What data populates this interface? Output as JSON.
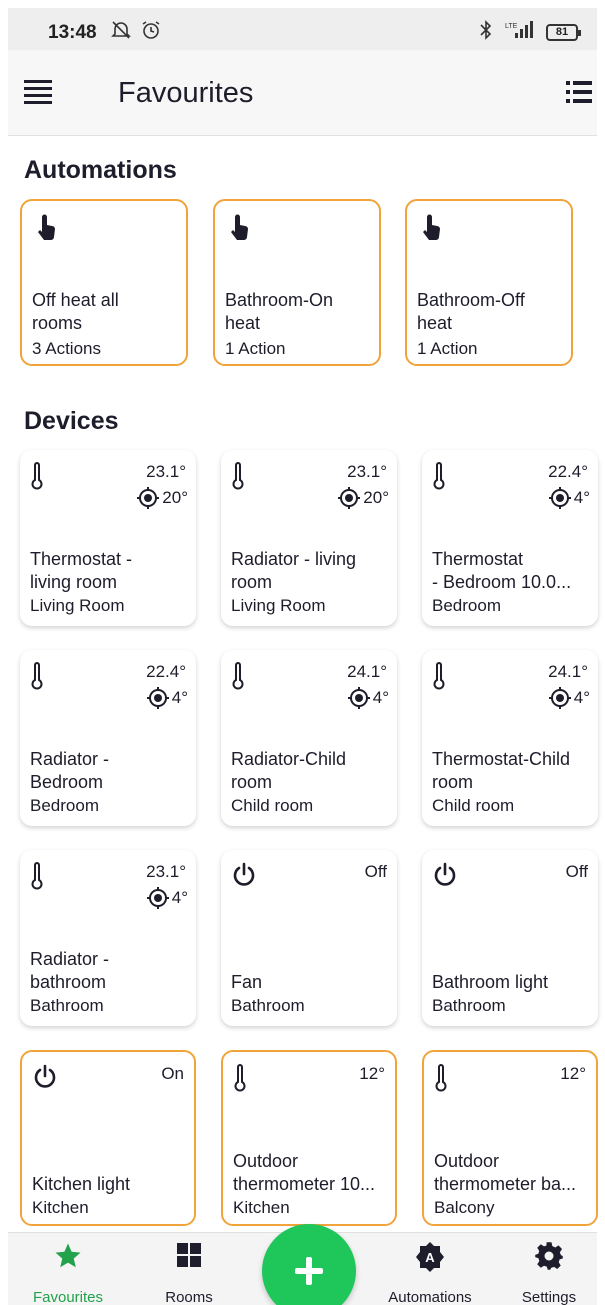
{
  "status": {
    "time": "13:48",
    "battery": "81"
  },
  "appbar": {
    "title": "Favourites"
  },
  "sections": {
    "automations": "Automations",
    "devices": "Devices"
  },
  "automations": [
    {
      "name": "Off heat all\nrooms",
      "sub": "3 Actions"
    },
    {
      "name": "Bathroom-On\nheat",
      "sub": "1 Action"
    },
    {
      "name": "Bathroom-Off\nheat",
      "sub": "1 Action"
    }
  ],
  "devices": [
    {
      "icon": "thermometer-icon",
      "value": "23.1°",
      "target": "20°",
      "name": "Thermostat -\nliving room",
      "room": "Living Room"
    },
    {
      "icon": "thermometer-icon",
      "value": "23.1°",
      "target": "20°",
      "name": "Radiator - living\nroom",
      "room": "Living Room"
    },
    {
      "icon": "thermometer-icon",
      "value": "22.4°",
      "target": "4°",
      "name": "Thermostat\n- Bedroom 10.0...",
      "room": "Bedroom"
    },
    {
      "icon": "thermometer-icon",
      "value": "22.4°",
      "target": "4°",
      "name": "Radiator -\nBedroom",
      "room": "Bedroom"
    },
    {
      "icon": "thermometer-icon",
      "value": "24.1°",
      "target": "4°",
      "name": "Radiator-Child\nroom",
      "room": "Child room"
    },
    {
      "icon": "thermometer-icon",
      "value": "24.1°",
      "target": "4°",
      "name": "Thermostat-Child\nroom",
      "room": "Child room"
    },
    {
      "icon": "thermometer-icon",
      "value": "23.1°",
      "target": "4°",
      "name": "Radiator -\nbathroom",
      "room": "Bathroom"
    },
    {
      "icon": "power-icon",
      "value": "Off",
      "target": "",
      "name": "Fan",
      "room": "Bathroom"
    },
    {
      "icon": "power-icon",
      "value": "Off",
      "target": "",
      "name": "Bathroom light",
      "room": "Bathroom"
    },
    {
      "icon": "power-icon",
      "value": "On",
      "target": "",
      "name": "Kitchen light",
      "room": "Kitchen"
    },
    {
      "icon": "thermometer-icon",
      "value": "12°",
      "target": "",
      "name": "Outdoor\nthermometer 10...",
      "room": "Kitchen"
    },
    {
      "icon": "thermometer-icon",
      "value": "12°",
      "target": "",
      "name": "Outdoor\nthermometer ba...",
      "room": "Balcony"
    }
  ],
  "nav": {
    "favourites": "Favourites",
    "rooms": "Rooms",
    "automations": "Automations",
    "settings": "Settings"
  },
  "colors": {
    "accent_green": "#22a24a",
    "fab_green": "#1fc65a",
    "highlight_orange": "#f0a43a"
  }
}
